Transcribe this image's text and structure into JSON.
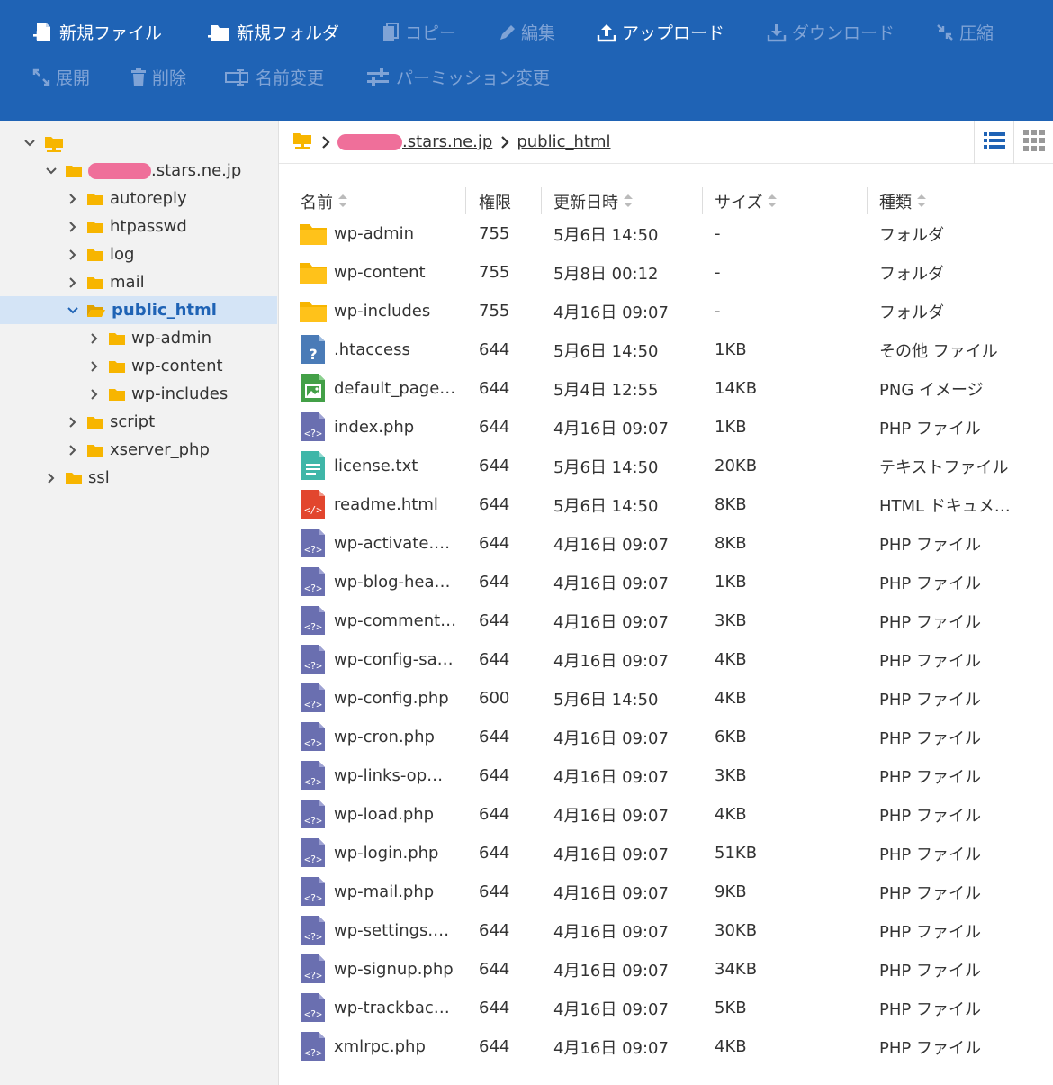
{
  "toolbar": {
    "row1": [
      {
        "label": "新規ファイル",
        "icon": "new-file-icon",
        "enabled": true
      },
      {
        "label": "新規フォルダ",
        "icon": "new-folder-icon",
        "enabled": true
      },
      {
        "label": "コピー",
        "icon": "copy-icon",
        "enabled": false
      },
      {
        "label": "編集",
        "icon": "pencil-icon",
        "enabled": false
      },
      {
        "label": "アップロード",
        "icon": "upload-icon",
        "enabled": true
      },
      {
        "label": "ダウンロード",
        "icon": "download-icon",
        "enabled": false
      },
      {
        "label": "圧縮",
        "icon": "compress-icon",
        "enabled": false
      }
    ],
    "row2": [
      {
        "label": "展開",
        "icon": "expand-icon",
        "enabled": false
      },
      {
        "label": "削除",
        "icon": "trash-icon",
        "enabled": false
      },
      {
        "label": "名前変更",
        "icon": "rename-icon",
        "enabled": false
      },
      {
        "label": "パーミッション変更",
        "icon": "permission-icon",
        "enabled": false
      }
    ]
  },
  "tree": [
    {
      "label": "",
      "level": 0,
      "expanded": true,
      "root": true
    },
    {
      "label": ".stars.ne.jp",
      "level": 1,
      "expanded": true,
      "redacted": true
    },
    {
      "label": "autoreply",
      "level": 2,
      "expanded": false
    },
    {
      "label": "htpasswd",
      "level": 2,
      "expanded": false
    },
    {
      "label": "log",
      "level": 2,
      "expanded": false
    },
    {
      "label": "mail",
      "level": 2,
      "expanded": false
    },
    {
      "label": "public_html",
      "level": 2,
      "expanded": true,
      "selected": true
    },
    {
      "label": "wp-admin",
      "level": 3,
      "expanded": false
    },
    {
      "label": "wp-content",
      "level": 3,
      "expanded": false
    },
    {
      "label": "wp-includes",
      "level": 3,
      "expanded": false
    },
    {
      "label": "script",
      "level": 2,
      "expanded": false
    },
    {
      "label": "xserver_php",
      "level": 2,
      "expanded": false
    },
    {
      "label": "ssl",
      "level": 1,
      "expanded": false
    }
  ],
  "breadcrumb": {
    "domain": ".stars.ne.jp",
    "current": "public_html"
  },
  "columns": {
    "name": "名前",
    "perm": "権限",
    "date": "更新日時",
    "size": "サイズ",
    "kind": "種類"
  },
  "files": [
    {
      "name": "wp-admin",
      "perm": "755",
      "date": "5月6日 14:50",
      "size": "-",
      "kind": "フォルダ",
      "icon": "folder"
    },
    {
      "name": "wp-content",
      "perm": "755",
      "date": "5月8日 00:12",
      "size": "-",
      "kind": "フォルダ",
      "icon": "folder"
    },
    {
      "name": "wp-includes",
      "perm": "755",
      "date": "4月16日 09:07",
      "size": "-",
      "kind": "フォルダ",
      "icon": "folder"
    },
    {
      "name": ".htaccess",
      "perm": "644",
      "date": "5月6日 14:50",
      "size": "1KB",
      "kind": "その他 ファイル",
      "icon": "unknown"
    },
    {
      "name": "default_page…",
      "perm": "644",
      "date": "5月4日 12:55",
      "size": "14KB",
      "kind": "PNG イメージ",
      "icon": "image"
    },
    {
      "name": "index.php",
      "perm": "644",
      "date": "4月16日 09:07",
      "size": "1KB",
      "kind": "PHP ファイル",
      "icon": "php"
    },
    {
      "name": "license.txt",
      "perm": "644",
      "date": "5月6日 14:50",
      "size": "20KB",
      "kind": "テキストファイル",
      "icon": "text"
    },
    {
      "name": "readme.html",
      "perm": "644",
      "date": "5月6日 14:50",
      "size": "8KB",
      "kind": "HTML ドキュメ…",
      "icon": "html"
    },
    {
      "name": "wp-activate.…",
      "perm": "644",
      "date": "4月16日 09:07",
      "size": "8KB",
      "kind": "PHP ファイル",
      "icon": "php"
    },
    {
      "name": "wp-blog-hea…",
      "perm": "644",
      "date": "4月16日 09:07",
      "size": "1KB",
      "kind": "PHP ファイル",
      "icon": "php"
    },
    {
      "name": "wp-comment…",
      "perm": "644",
      "date": "4月16日 09:07",
      "size": "3KB",
      "kind": "PHP ファイル",
      "icon": "php"
    },
    {
      "name": "wp-config-sa…",
      "perm": "644",
      "date": "4月16日 09:07",
      "size": "4KB",
      "kind": "PHP ファイル",
      "icon": "php"
    },
    {
      "name": "wp-config.php",
      "perm": "600",
      "date": "5月6日 14:50",
      "size": "4KB",
      "kind": "PHP ファイル",
      "icon": "php"
    },
    {
      "name": "wp-cron.php",
      "perm": "644",
      "date": "4月16日 09:07",
      "size": "6KB",
      "kind": "PHP ファイル",
      "icon": "php"
    },
    {
      "name": "wp-links-op…",
      "perm": "644",
      "date": "4月16日 09:07",
      "size": "3KB",
      "kind": "PHP ファイル",
      "icon": "php"
    },
    {
      "name": "wp-load.php",
      "perm": "644",
      "date": "4月16日 09:07",
      "size": "4KB",
      "kind": "PHP ファイル",
      "icon": "php"
    },
    {
      "name": "wp-login.php",
      "perm": "644",
      "date": "4月16日 09:07",
      "size": "51KB",
      "kind": "PHP ファイル",
      "icon": "php"
    },
    {
      "name": "wp-mail.php",
      "perm": "644",
      "date": "4月16日 09:07",
      "size": "9KB",
      "kind": "PHP ファイル",
      "icon": "php"
    },
    {
      "name": "wp-settings.…",
      "perm": "644",
      "date": "4月16日 09:07",
      "size": "30KB",
      "kind": "PHP ファイル",
      "icon": "php"
    },
    {
      "name": "wp-signup.php",
      "perm": "644",
      "date": "4月16日 09:07",
      "size": "34KB",
      "kind": "PHP ファイル",
      "icon": "php"
    },
    {
      "name": "wp-trackbac…",
      "perm": "644",
      "date": "4月16日 09:07",
      "size": "5KB",
      "kind": "PHP ファイル",
      "icon": "php"
    },
    {
      "name": "xmlrpc.php",
      "perm": "644",
      "date": "4月16日 09:07",
      "size": "4KB",
      "kind": "PHP ファイル",
      "icon": "php"
    }
  ],
  "colors": {
    "toolbar_bg": "#1f63b5",
    "folder": "#f7b500",
    "php": "#6a6fb0",
    "text": "#3fb6a8",
    "html": "#e2462e",
    "image": "#43a047",
    "unknown": "#4a7bb7",
    "selected_bg": "#d4e4f6"
  }
}
